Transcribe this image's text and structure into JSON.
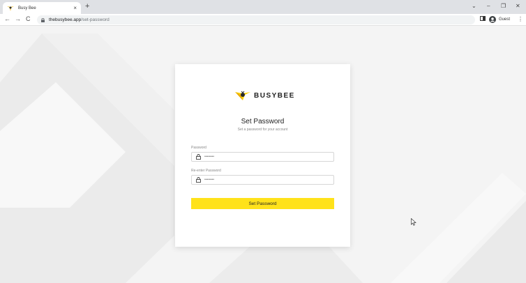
{
  "browser": {
    "tab_title": "Busy Bee",
    "tab_close": "×",
    "new_tab": "+",
    "url_host": "thebusybee.app",
    "url_path": "/set-password",
    "profile_label": "Guest",
    "nav": {
      "back": "←",
      "forward": "→",
      "reload": "C"
    },
    "window": {
      "minimize": "–",
      "restore": "❐",
      "close": "✕",
      "tab_list": "⌄"
    },
    "menu": "⋮"
  },
  "brand": {
    "name": "BUSYBEE",
    "accent": "#ffe21a"
  },
  "form": {
    "title": "Set Password",
    "subtitle": "Set a password for your account",
    "password_label": "Password",
    "password_placeholder": "••••••••",
    "confirm_label": "Re-enter Password",
    "confirm_placeholder": "••••••••",
    "submit_label": "Set Password"
  }
}
